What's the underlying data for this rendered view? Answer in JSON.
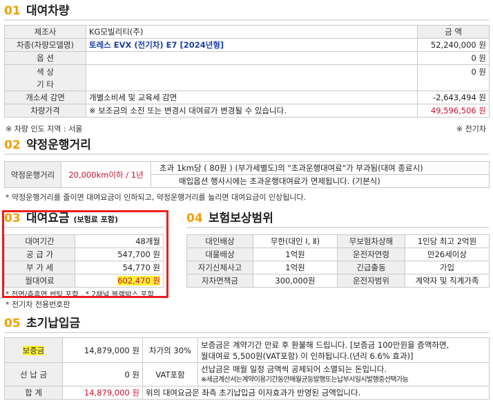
{
  "sec1": {
    "num": "01",
    "title": "대여차량",
    "header": {
      "label": "제조사",
      "value": "KG모빌리티(주)",
      "amount_label": "금 액"
    },
    "rows": [
      {
        "label": "차종(차량모델명)",
        "desc": "토레스 EVX (전기차) E7 [2024년형]",
        "amount": "52,240,000 원"
      },
      {
        "label": "옵 션",
        "desc": "",
        "amount": "0 원"
      },
      {
        "label": "색 상\n기 타",
        "desc": "",
        "amount": "0 원"
      },
      {
        "label": "개소세 감면",
        "desc": "개별소비세 및 교육세 감면",
        "amount": "-2,643,494 원"
      },
      {
        "label": "차량가격",
        "desc": "※ 보조금의 소진 또는 변경시 대여료가 변경될 수 있습니다.",
        "amount": "49,596,506 원"
      }
    ],
    "note_left": "※ 차량 인도 지역 : 서울",
    "note_right": "※ 전기차"
  },
  "sec2": {
    "num": "02",
    "title": "약정운행거리",
    "label": "약정운행거리",
    "value": "20,000km이하 / 1년",
    "line1": "초과 1km당 ( 80원 ) (부가세별도)의 \"초과운행대여료\"가 부과됨(대여 종료시)",
    "line2": "매입옵션 행사시에는 초과운행대여료가 면제됩니다. (기본식)",
    "note": "* 약정운행거리를 줄이면 대여요금이 인하되고, 약정운행거리를 늘리면 대여요금이 인상됩니다."
  },
  "sec3": {
    "num": "03",
    "title": "대여요금",
    "sub": "(보험료 포함)",
    "rows": [
      {
        "label": "대여기간",
        "value": "48개월"
      },
      {
        "label": "공 급 가",
        "value": "547,700 원"
      },
      {
        "label": "부 가 세",
        "value": "54,770 원"
      },
      {
        "label": "월대여료",
        "value": "602,470 원"
      }
    ],
    "note1": "* 전면/측후면 썬팅 포함 , * 2채널 블랙박스 포함",
    "note2": "* 전기차 전용번호판"
  },
  "sec4": {
    "num": "04",
    "title": "보험보상범위",
    "rows": [
      [
        "대인배상",
        "무한(대인 Ⅰ, Ⅱ)",
        "무보험차상해",
        "1인당 최고 2억원"
      ],
      [
        "대물배상",
        "1억원",
        "운전자연령",
        "만26세이상"
      ],
      [
        "자기신체사고",
        "1억원",
        "긴급출동",
        "가입"
      ],
      [
        "자차면책금",
        "300,000원",
        "운전자범위",
        "계약자 및 직계가족"
      ]
    ]
  },
  "sec5": {
    "num": "05",
    "title": "초기납입금",
    "deposit": {
      "label": "보증금",
      "value": "14,879,000 원",
      "pct": "차가의 30%",
      "desc1": "보증금은 계약기간 만료 후 환불해 드립니다. [보증금 100만원을 증액하면,",
      "desc2": "월대여료 5,500원(VAT포함) 이 인하됩니다.(년리 6.6% 효과)]"
    },
    "prepay": {
      "label": "선 납 금",
      "value": "0 원",
      "pct": "VAT포함",
      "desc1": "선납금은 매월 일정 금액씩 공제되어 소멸되는 돈입니다.",
      "desc2": "※세금계산서는계약이용기간동안매월균등발행또는납부시일시발행중선택가능"
    },
    "total": {
      "label": "합 계",
      "value": "14,879,000 원",
      "desc": "위의 대여요금은 좌측 초기납입금 이자효과가 반영된 금액입니다."
    }
  }
}
